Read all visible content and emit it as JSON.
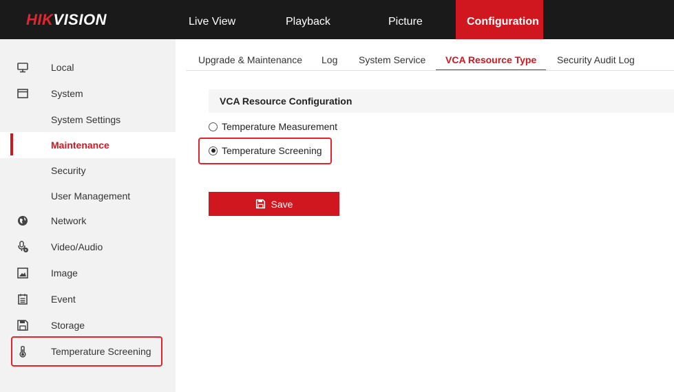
{
  "brand": {
    "hik": "HIK",
    "vision": "VISION"
  },
  "topnav": [
    {
      "label": "Live View"
    },
    {
      "label": "Playback"
    },
    {
      "label": "Picture"
    },
    {
      "label": "Configuration"
    }
  ],
  "sidebar": {
    "items": [
      {
        "label": "Local",
        "icon": "monitor-icon"
      },
      {
        "label": "System",
        "icon": "window-icon"
      },
      {
        "label": "System Settings"
      },
      {
        "label": "Maintenance"
      },
      {
        "label": "Security"
      },
      {
        "label": "User Management"
      },
      {
        "label": "Network",
        "icon": "globe-icon"
      },
      {
        "label": "Video/Audio",
        "icon": "microphone-icon"
      },
      {
        "label": "Image",
        "icon": "image-icon"
      },
      {
        "label": "Event",
        "icon": "calendar-icon"
      },
      {
        "label": "Storage",
        "icon": "floppy-icon"
      },
      {
        "label": "Temperature Screening",
        "icon": "thermometer-icon"
      }
    ]
  },
  "tabs": [
    {
      "label": "Upgrade & Maintenance"
    },
    {
      "label": "Log"
    },
    {
      "label": "System Service"
    },
    {
      "label": "VCA Resource Type"
    },
    {
      "label": "Security Audit Log"
    }
  ],
  "content": {
    "section_title": "VCA Resource Configuration",
    "options": [
      {
        "label": "Temperature Measurement",
        "checked": false
      },
      {
        "label": "Temperature Screening",
        "checked": true
      }
    ],
    "save_label": "Save"
  },
  "colors": {
    "accent": "#d0161e",
    "header_bg": "#1a1a1a",
    "sidebar_bg": "#f2f2f2",
    "highlight": "#e5222b"
  }
}
